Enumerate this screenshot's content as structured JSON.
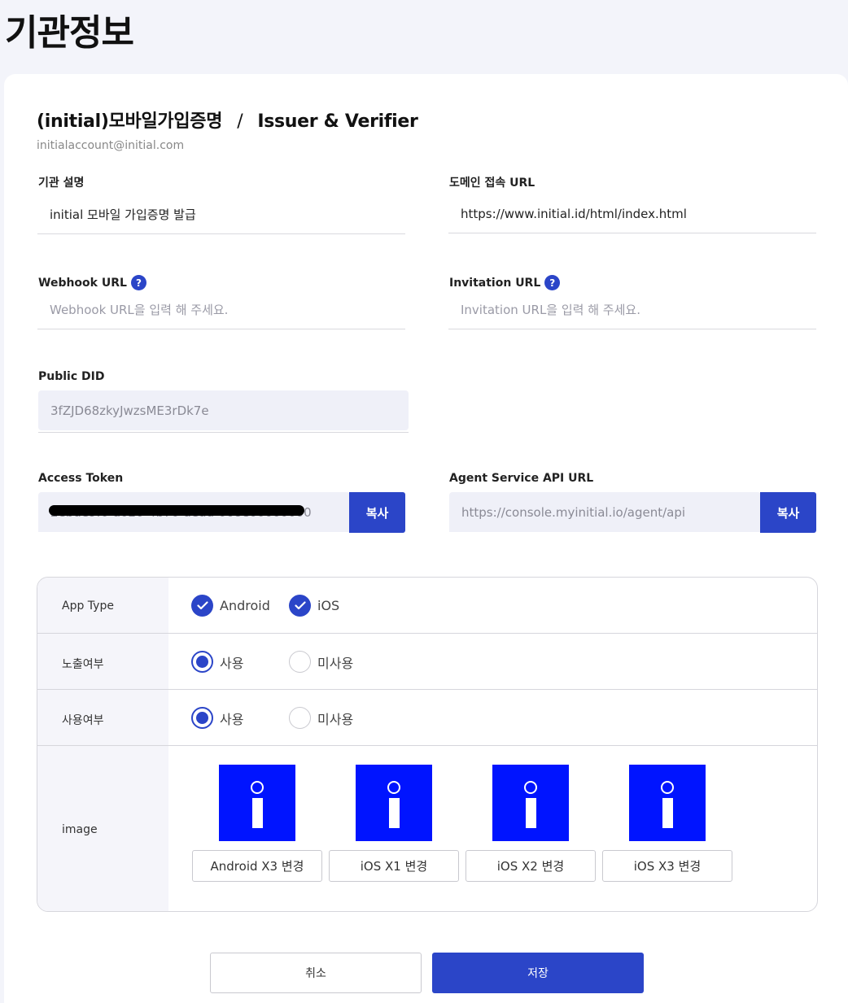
{
  "page": {
    "title": "기관정보"
  },
  "org": {
    "name": "(initial)모바일가입증명",
    "separator": "/",
    "role": "Issuer & Verifier",
    "email": "initialaccount@initial.com"
  },
  "fields": {
    "description": {
      "label": "기관 설명",
      "value": "initial 모바일 가입증명 발급"
    },
    "domain_url": {
      "label": "도메인 접속 URL",
      "value": "https://www.initial.id/html/index.html"
    },
    "webhook_url": {
      "label": "Webhook URL",
      "help": "?",
      "value": "",
      "placeholder": "Webhook URL을 입력 해 주세요."
    },
    "invitation_url": {
      "label": "Invitation URL",
      "help": "?",
      "value": "",
      "placeholder": "Invitation URL을 입력 해 주세요."
    },
    "public_did": {
      "label": "Public DID",
      "value": "3fZJD68zkyJwzsME3rDk7e"
    },
    "access_token": {
      "label": "Access Token",
      "value": "2ebde9f0-a020-4b70-aedd-068e00000000",
      "copy_label": "복사"
    },
    "agent_api_url": {
      "label": "Agent Service API URL",
      "value": "https://console.myinitial.io/agent/api",
      "copy_label": "복사"
    }
  },
  "settings": {
    "app_type": {
      "label": "App Type",
      "options": [
        {
          "label": "Android",
          "checked": true
        },
        {
          "label": "iOS",
          "checked": true
        }
      ]
    },
    "exposure": {
      "label": "노출여부",
      "options": [
        {
          "label": "사용",
          "selected": true
        },
        {
          "label": "미사용",
          "selected": false
        }
      ]
    },
    "usage": {
      "label": "사용여부",
      "options": [
        {
          "label": "사용",
          "selected": true
        },
        {
          "label": "미사용",
          "selected": false
        }
      ]
    },
    "image": {
      "label": "image",
      "icon": "initial-info-icon",
      "icon_color": "#0014ff",
      "buttons": [
        "Android X3 변경",
        "iOS X1 변경",
        "iOS X2 변경",
        "iOS X3 변경"
      ]
    }
  },
  "actions": {
    "cancel": "취소",
    "save": "저장"
  },
  "colors": {
    "accent": "#2b45c8",
    "background": "#f3f4fa"
  }
}
